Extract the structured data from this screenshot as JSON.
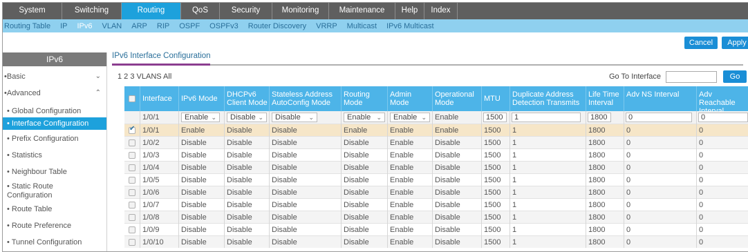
{
  "top_nav": [
    {
      "label": "System",
      "active": false
    },
    {
      "label": "Switching",
      "active": false
    },
    {
      "label": "Routing",
      "active": true
    },
    {
      "label": "QoS",
      "active": false
    },
    {
      "label": "Security",
      "active": false
    },
    {
      "label": "Monitoring",
      "active": false
    },
    {
      "label": "Maintenance",
      "active": false
    },
    {
      "label": "Help",
      "active": false
    },
    {
      "label": "Index",
      "active": false
    }
  ],
  "sub_nav": [
    {
      "label": "Routing Table",
      "active": false
    },
    {
      "label": "IP",
      "active": false
    },
    {
      "label": "IPv6",
      "active": true
    },
    {
      "label": "VLAN",
      "active": false
    },
    {
      "label": "ARP",
      "active": false
    },
    {
      "label": "RIP",
      "active": false
    },
    {
      "label": "OSPF",
      "active": false
    },
    {
      "label": "OSPFv3",
      "active": false
    },
    {
      "label": "Router Discovery",
      "active": false
    },
    {
      "label": "VRRP",
      "active": false
    },
    {
      "label": "Multicast",
      "active": false
    },
    {
      "label": "IPv6 Multicast",
      "active": false
    }
  ],
  "actions": {
    "cancel": "Cancel",
    "apply": "Apply"
  },
  "sidebar": {
    "title": "IPv6",
    "items": [
      {
        "label": "•Basic",
        "arrow": "⌄",
        "selected": false
      },
      {
        "label": "•Advanced",
        "arrow": "⌃",
        "selected": false
      },
      {
        "label": "• Global Configuration",
        "selected": false
      },
      {
        "label": "• Interface Configuration",
        "selected": true
      },
      {
        "label": "• Prefix Configuration",
        "selected": false
      },
      {
        "label": "• Statistics",
        "selected": false
      },
      {
        "label": "• Neighbour Table",
        "selected": false
      },
      {
        "label": "• Static Route\nConfiguration",
        "selected": false
      },
      {
        "label": "• Route Table",
        "selected": false
      },
      {
        "label": "• Route Preference",
        "selected": false
      },
      {
        "label": "• Tunnel Configuration",
        "selected": false
      }
    ]
  },
  "main": {
    "title": "IPv6 Interface Configuration",
    "pager": "1 2 3 VLANS All",
    "goto_label": "Go To Interface",
    "goto_button": "Go",
    "goto_value": ""
  },
  "table": {
    "headers": [
      "Interface",
      "IPv6 Mode",
      "DHCPv6 Client Mode",
      "Stateless Address AutoConfig Mode",
      "Routing Mode",
      "Admin Mode",
      "Operational Mode",
      "MTU",
      "Duplicate Address Detection Transmits",
      "Life Time Interval",
      "Adv NS Interval",
      "Adv Reachable Interval"
    ],
    "edit_row": {
      "interface": "1/0/1",
      "ipv6_mode": "Enable",
      "dhcp_mode": "Disable",
      "stateless_mode": "Disable",
      "routing_mode": "Enable",
      "admin_mode": "Enable",
      "operational_mode": "Enable",
      "mtu": "1500",
      "dad": "1",
      "life_time": "1800",
      "adv_ns": "0",
      "adv_reach": "0"
    },
    "rows": [
      {
        "checked": true,
        "cells": [
          "1/0/1",
          "Enable",
          "Disable",
          "Disable",
          "Enable",
          "Enable",
          "Enable",
          "1500",
          "1",
          "1800",
          "0",
          "0"
        ]
      },
      {
        "checked": false,
        "cells": [
          "1/0/2",
          "Disable",
          "Disable",
          "Disable",
          "Disable",
          "Enable",
          "Disable",
          "1500",
          "1",
          "1800",
          "0",
          "0"
        ]
      },
      {
        "checked": false,
        "cells": [
          "1/0/3",
          "Disable",
          "Disable",
          "Disable",
          "Disable",
          "Enable",
          "Disable",
          "1500",
          "1",
          "1800",
          "0",
          "0"
        ]
      },
      {
        "checked": false,
        "cells": [
          "1/0/4",
          "Disable",
          "Disable",
          "Disable",
          "Disable",
          "Enable",
          "Disable",
          "1500",
          "1",
          "1800",
          "0",
          "0"
        ]
      },
      {
        "checked": false,
        "cells": [
          "1/0/5",
          "Disable",
          "Disable",
          "Disable",
          "Disable",
          "Enable",
          "Disable",
          "1500",
          "1",
          "1800",
          "0",
          "0"
        ]
      },
      {
        "checked": false,
        "cells": [
          "1/0/6",
          "Disable",
          "Disable",
          "Disable",
          "Disable",
          "Enable",
          "Disable",
          "1500",
          "1",
          "1800",
          "0",
          "0"
        ]
      },
      {
        "checked": false,
        "cells": [
          "1/0/7",
          "Disable",
          "Disable",
          "Disable",
          "Disable",
          "Enable",
          "Disable",
          "1500",
          "1",
          "1800",
          "0",
          "0"
        ]
      },
      {
        "checked": false,
        "cells": [
          "1/0/8",
          "Disable",
          "Disable",
          "Disable",
          "Disable",
          "Enable",
          "Disable",
          "1500",
          "1",
          "1800",
          "0",
          "0"
        ]
      },
      {
        "checked": false,
        "cells": [
          "1/0/9",
          "Disable",
          "Disable",
          "Disable",
          "Disable",
          "Enable",
          "Disable",
          "1500",
          "1",
          "1800",
          "0",
          "0"
        ]
      },
      {
        "checked": false,
        "cells": [
          "1/0/10",
          "Disable",
          "Disable",
          "Disable",
          "Disable",
          "Enable",
          "Disable",
          "1500",
          "1",
          "1800",
          "0",
          "0"
        ]
      }
    ]
  },
  "colors": {
    "nav_bg": "#5f5f5f",
    "accent": "#1da1dc",
    "subnav_bg": "#8fd0ef",
    "header_bg": "#4db4e8",
    "selected_row": "#f6e6c8"
  }
}
